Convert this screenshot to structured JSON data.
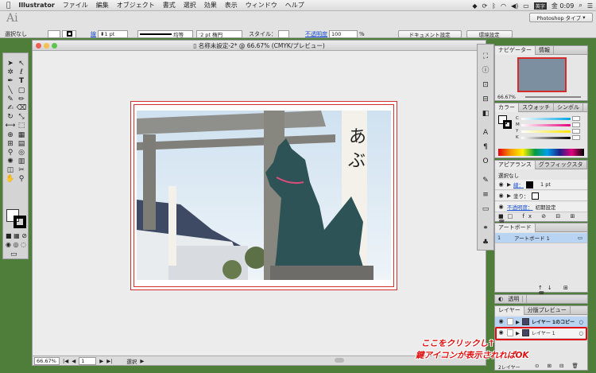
{
  "menubar": {
    "apple": "",
    "items": [
      "Illustrator",
      "ファイル",
      "編集",
      "オブジェクト",
      "書式",
      "選択",
      "効果",
      "表示",
      "ウィンドウ",
      "ヘルプ"
    ],
    "ime": "英字",
    "clock": "金 0:09",
    "workspace": "Photoshop タイプ"
  },
  "control": {
    "selection": "選択なし",
    "stroke_label": "線",
    "stroke_weight": "1 pt",
    "uniform": "均等",
    "brush": "2 pt 楕円",
    "style_label": "スタイル：",
    "opacity_label": "不透明度",
    "opacity": "100",
    "percent": "%",
    "doc_setup": "ドキュメント設定",
    "prefs": "環境設定"
  },
  "document": {
    "title": "名称未設定-2* @ 66.67% (CMYK/プレビュー)",
    "zoom": "66.67%",
    "page": "1",
    "status": "選択"
  },
  "panels": {
    "navigator_tabs": [
      "ナビゲーター",
      "情報"
    ],
    "nav_zoom": "66.67%",
    "color_tabs": [
      "カラー",
      "スウォッチ",
      "シンボル"
    ],
    "cmyk": [
      "C",
      "M",
      "Y",
      "K"
    ],
    "appearance_tabs": [
      "アピアランス",
      "グラフィックスタ"
    ],
    "appearance_header": "選択なし",
    "appearance_stroke": "線：",
    "appearance_stroke_val": "1 pt",
    "appearance_fill": "塗り：",
    "appearance_opacity": "不透明度：",
    "appearance_opacity_val": "初期設定",
    "artboard_tab": "アートボード",
    "artboard_row_num": "1",
    "artboard_row_name": "アートボード 1",
    "transparency_tab": "透明",
    "layer_tabs": [
      "レイヤー",
      "分版プレビュー"
    ],
    "layer1": "レイヤー 1のコピー",
    "layer2": "レイヤー 1",
    "layer_count": "2レイヤー"
  },
  "callout": {
    "line1": "ここをクリックし↑",
    "line2": "鍵アイコンが表示されればOK"
  },
  "colors": {
    "annotation": "#e01010",
    "selection_blue": "#b9d3f2"
  }
}
